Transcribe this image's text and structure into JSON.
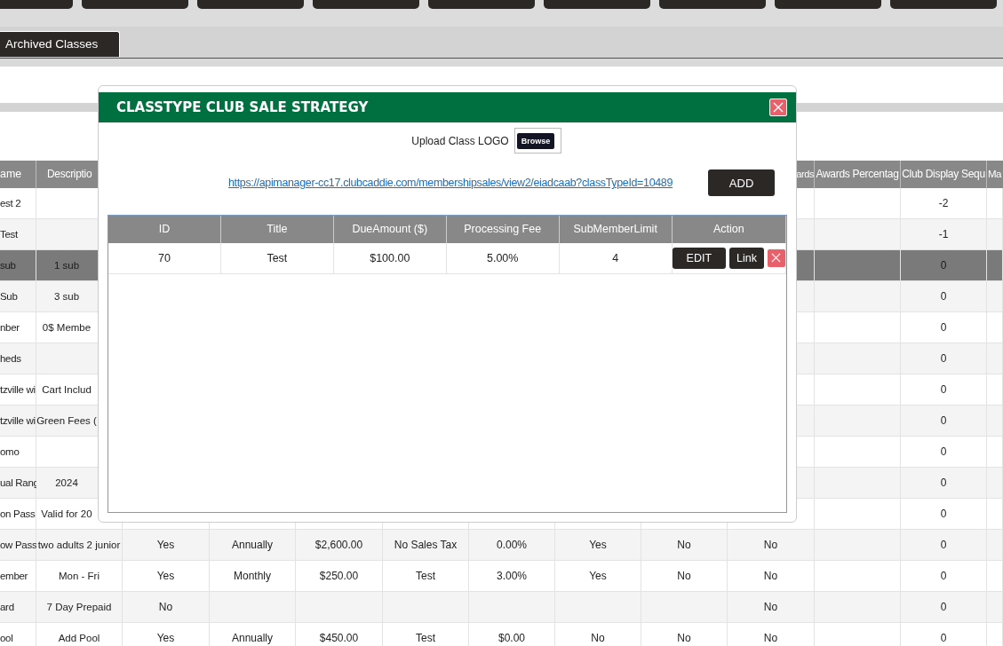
{
  "tabs": [
    {
      "label": "Archived Classes"
    }
  ],
  "table": {
    "columns": [
      {
        "label": "ame"
      },
      {
        "label": "Descriptio"
      },
      null,
      null,
      null,
      null,
      null,
      null,
      null,
      {
        "label": "ards"
      },
      {
        "label": "Awards Percentag"
      },
      {
        "label": "Club Display Sequ"
      },
      {
        "label": "Ma"
      }
    ],
    "rows": [
      {
        "selected": false,
        "cells": [
          "est 2",
          null,
          null,
          null,
          null,
          null,
          null,
          null,
          null,
          null,
          null,
          "-2",
          null
        ]
      },
      {
        "selected": false,
        "cells": [
          "Test",
          null,
          null,
          null,
          null,
          null,
          null,
          null,
          null,
          null,
          null,
          "-1",
          null
        ]
      },
      {
        "selected": true,
        "cells": [
          "sub",
          "1 sub",
          null,
          null,
          null,
          null,
          null,
          null,
          null,
          null,
          null,
          "0",
          null
        ]
      },
      {
        "selected": false,
        "cells": [
          "Sub",
          "3 sub",
          null,
          null,
          null,
          null,
          null,
          null,
          null,
          null,
          null,
          "0",
          null
        ]
      },
      {
        "selected": false,
        "cells": [
          "nber",
          "0$ Membe",
          null,
          null,
          null,
          null,
          null,
          null,
          null,
          null,
          null,
          "0",
          null
        ]
      },
      {
        "selected": false,
        "cells": [
          "heds",
          null,
          null,
          null,
          null,
          null,
          null,
          null,
          null,
          null,
          null,
          "0",
          null
        ]
      },
      {
        "selected": false,
        "cells": [
          "tzville wi",
          "Cart Includ",
          null,
          null,
          null,
          null,
          null,
          null,
          null,
          null,
          null,
          "0",
          null
        ]
      },
      {
        "selected": false,
        "cells": [
          "tzville wi",
          "Green Fees (",
          null,
          null,
          null,
          null,
          null,
          null,
          null,
          null,
          null,
          "0",
          null
        ]
      },
      {
        "selected": false,
        "cells": [
          "omo",
          null,
          null,
          null,
          null,
          null,
          null,
          null,
          null,
          null,
          null,
          "0",
          null
        ]
      },
      {
        "selected": false,
        "cells": [
          "ual Rang",
          "2024",
          null,
          null,
          null,
          null,
          null,
          null,
          null,
          null,
          null,
          "0",
          null
        ]
      },
      {
        "selected": false,
        "cells": [
          "on Pass",
          "Valid for 20",
          null,
          null,
          null,
          null,
          null,
          null,
          null,
          null,
          null,
          "0",
          null
        ]
      },
      {
        "selected": false,
        "cells": [
          "ow Pass",
          "two adults 2 junior",
          "Yes",
          "Annually",
          "$2,600.00",
          "No Sales Tax",
          "0.00%",
          "Yes",
          "No",
          "No",
          null,
          "0",
          null
        ]
      },
      {
        "selected": false,
        "cells": [
          "ember",
          "Mon - Fri",
          "Yes",
          "Monthly",
          "$250.00",
          "Test",
          "3.00%",
          "Yes",
          "No",
          "No",
          null,
          "0",
          null
        ]
      },
      {
        "selected": false,
        "cells": [
          "ard",
          "7 Day Prepaid",
          "No",
          null,
          null,
          null,
          null,
          null,
          null,
          "No",
          null,
          "0",
          null
        ]
      },
      {
        "selected": false,
        "cells": [
          "ool",
          "Add Pool",
          "Yes",
          "Annually",
          "$450.00",
          "Test",
          "$0.00",
          "No",
          "No",
          "No",
          null,
          "0",
          null
        ]
      }
    ]
  },
  "modal": {
    "title": "CLASSTYPE CLUB SALE STRATEGY",
    "upload_label": "Upload Class LOGO",
    "browse_button": "Browse",
    "link": "https://apimanager-cc17.clubcaddie.com/membershipsales/view2/eiadcaab?classTypeId=10489",
    "add_button": "ADD",
    "table": {
      "columns": [
        "ID",
        "Title",
        "DueAmount ($)",
        "Processing Fee",
        "SubMemberLimit",
        "Action"
      ],
      "rows": [
        {
          "cells": [
            "70",
            "Test",
            "$100.00",
            "5.00%",
            "4"
          ],
          "actions": [
            "EDIT",
            "Link"
          ]
        }
      ]
    }
  }
}
